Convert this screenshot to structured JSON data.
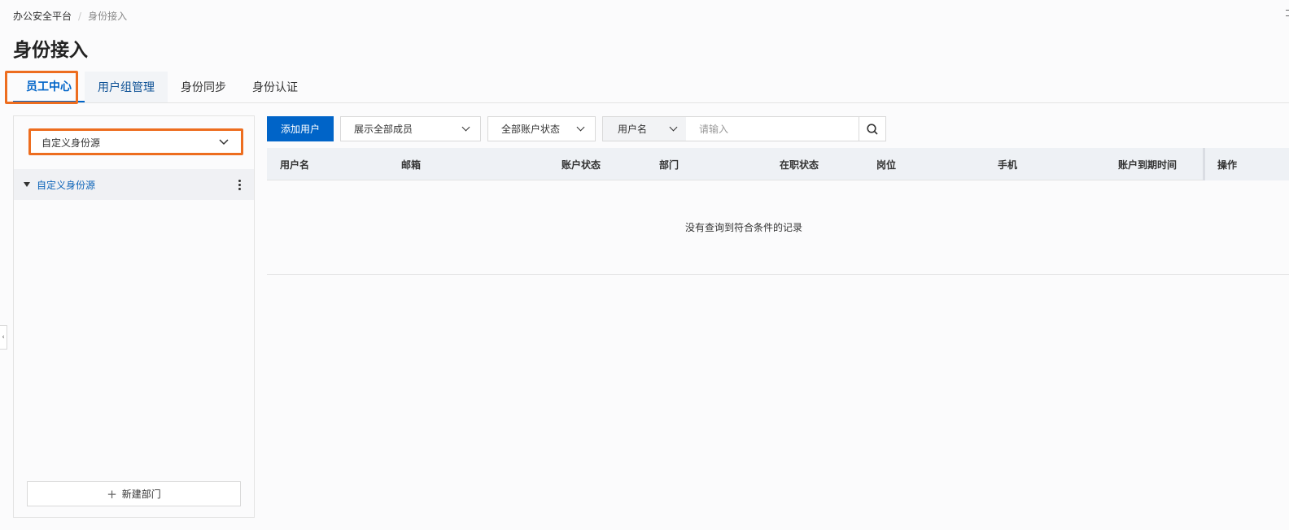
{
  "breadcrumb": {
    "root": "办公安全平台",
    "separator": "/",
    "current": "身份接入"
  },
  "page": {
    "title": "身份接入"
  },
  "tabs": [
    {
      "label": "员工中心"
    },
    {
      "label": "用户组管理"
    },
    {
      "label": "身份同步"
    },
    {
      "label": "身份认证"
    }
  ],
  "left_panel": {
    "source_select": "自定义身份源",
    "tree_node": "自定义身份源",
    "new_dept_button": "新建部门"
  },
  "toolbar": {
    "add_user": "添加用户",
    "member_filter": "展示全部成员",
    "status_filter": "全部账户状态",
    "search_type": "用户名",
    "search_placeholder": "请输入"
  },
  "table": {
    "columns": [
      "用户名",
      "邮箱",
      "账户状态",
      "部门",
      "在职状态",
      "岗位",
      "手机",
      "账户到期时间",
      "操作"
    ],
    "empty_text": "没有查询到符合条件的记录"
  },
  "colors": {
    "primary": "#0064c8",
    "highlight": "#ed6d1f"
  },
  "icons": [
    "chevron-down-icon",
    "search-icon",
    "caret-down-icon",
    "more-vertical-icon",
    "plus-icon",
    "collapse-icon"
  ]
}
